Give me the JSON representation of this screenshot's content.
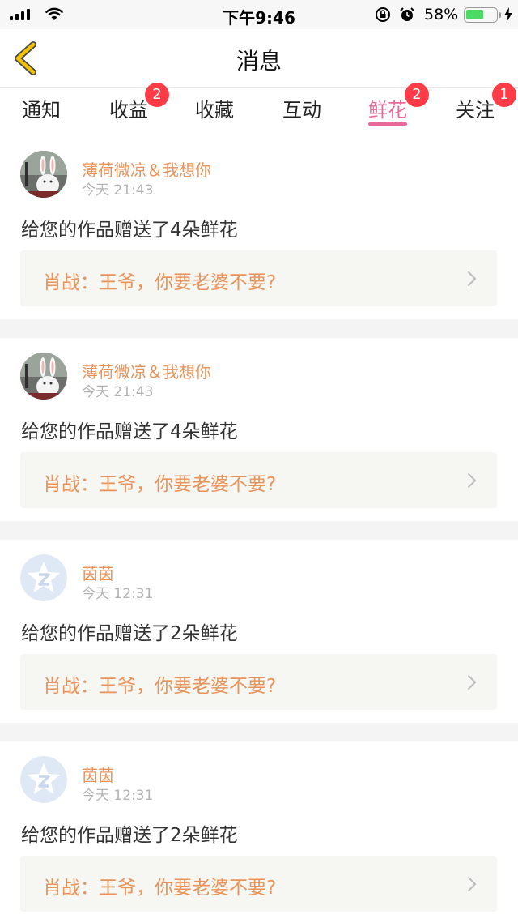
{
  "status_bar": {
    "time": "下午9:46",
    "battery_percent": "58%",
    "battery_level": 0.58,
    "icons": [
      "signal-icon",
      "wifi-icon",
      "orientation-lock-icon",
      "alarm-icon",
      "battery-icon",
      "charging-icon"
    ]
  },
  "nav": {
    "back_icon": "chevron-left-icon",
    "title": "消息"
  },
  "tabs": [
    {
      "label": "通知",
      "badge": ""
    },
    {
      "label": "收益",
      "badge": "2"
    },
    {
      "label": "收藏",
      "badge": ""
    },
    {
      "label": "互动",
      "badge": ""
    },
    {
      "label": "鲜花",
      "badge": "2",
      "active": true
    },
    {
      "label": "关注",
      "badge": "1"
    }
  ],
  "messages": [
    {
      "avatar": "rabbit-avatar",
      "sender": "薄荷微凉＆我想你",
      "time": "今天 21:43",
      "text": "给您的作品赠送了4朵鲜花",
      "work_title": "肖战：王爷，你要老婆不要?"
    },
    {
      "avatar": "rabbit-avatar",
      "sender": "薄荷微凉＆我想你",
      "time": "今天 21:43",
      "text": "给您的作品赠送了4朵鲜花",
      "work_title": "肖战：王爷，你要老婆不要?"
    },
    {
      "avatar": "default-avatar",
      "sender": "茵茵",
      "time": "今天 12:31",
      "text": "给您的作品赠送了2朵鲜花",
      "work_title": "肖战：王爷，你要老婆不要?"
    },
    {
      "avatar": "default-avatar",
      "sender": "茵茵",
      "time": "今天 12:31",
      "text": "给您的作品赠送了2朵鲜花",
      "work_title": "肖战：王爷，你要老婆不要?"
    }
  ],
  "colors": {
    "accent_pink": "#e8699a",
    "name_orange": "#e8935a",
    "badge_red": "#ff3b47",
    "back_arrow": "#f2c300"
  }
}
